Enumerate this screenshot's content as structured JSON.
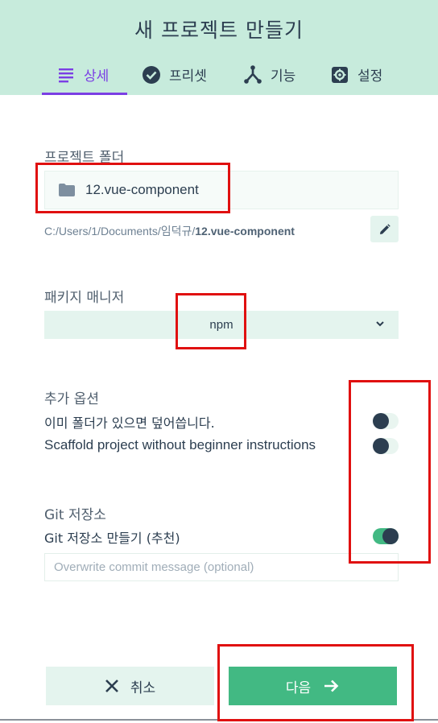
{
  "header": {
    "title": "새 프로젝트 만들기",
    "tabs": [
      {
        "label": "상세",
        "icon": "list-icon",
        "active": true
      },
      {
        "label": "프리셋",
        "icon": "check-circle-icon",
        "active": false
      },
      {
        "label": "기능",
        "icon": "merge-icon",
        "active": false
      },
      {
        "label": "설정",
        "icon": "gear-icon",
        "active": false
      }
    ]
  },
  "details": {
    "folder_label": "프로젝트 폴더",
    "folder_value": "12.vue-component",
    "path_prefix": "C:/Users/1/Documents/임덕규/",
    "path_bold": "12.vue-component",
    "package_manager_label": "패키지 매니저",
    "package_manager_value": "npm",
    "extra_options_label": "추가 옵션",
    "overwrite_label": "이미 폴더가 있으면 덮어씁니다.",
    "overwrite_on": false,
    "scaffold_label": "Scaffold project without beginner instructions",
    "scaffold_on": false,
    "git_section_label": "Git 저장소",
    "git_create_label": "Git 저장소 만들기 (추천)",
    "git_create_on": true,
    "commit_placeholder": "Overwrite commit message (optional)"
  },
  "footer": {
    "cancel_label": "취소",
    "next_label": "다음"
  },
  "colors": {
    "header_bg": "#c7ebdc",
    "accent_purple": "#7b3fe4",
    "primary_green": "#42b983",
    "text_dark": "#2c3e50",
    "annotation_red": "#e01010"
  }
}
